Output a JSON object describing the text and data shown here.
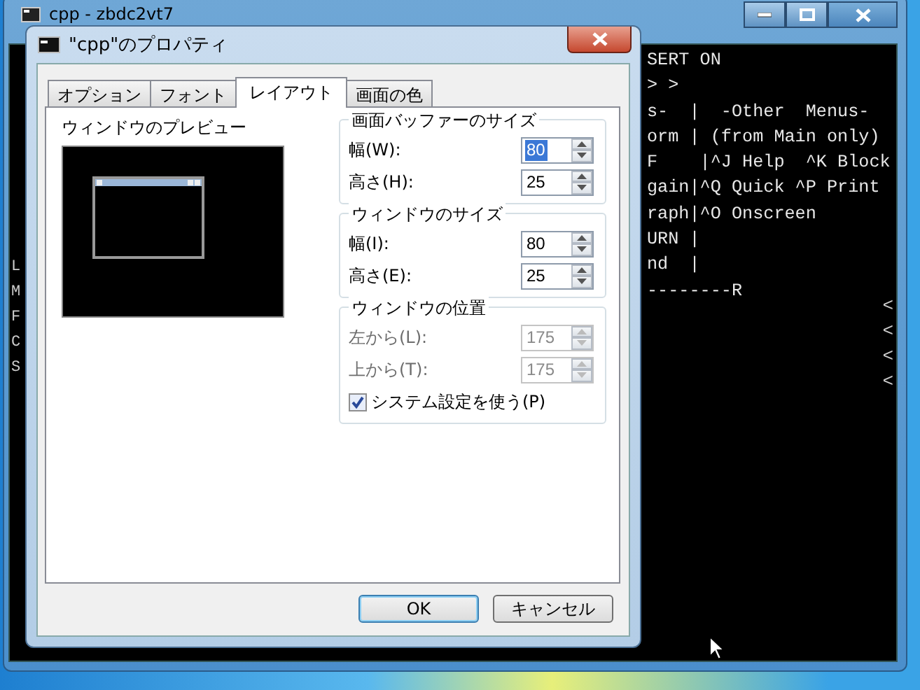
{
  "console_window": {
    "title": "cpp - zbdc2vt7",
    "lines": [
      "SERT ON",
      "> >",
      "s-  |  -Other  Menus-",
      "orm | (from Main only)",
      "F    |^J Help  ^K Block",
      "gain|^Q Quick ^P Print",
      "raph|^O Onscreen",
      "URN |",
      "nd  |",
      "--------R"
    ],
    "left_column": [
      "L",
      "M",
      "F",
      "C",
      "S"
    ],
    "right_column": [
      "<",
      "<",
      "<",
      "<"
    ]
  },
  "dialog": {
    "title": "\"cpp\"のプロパティ",
    "tabs": [
      {
        "label": "オプション",
        "selected": false
      },
      {
        "label": "フォント",
        "selected": false
      },
      {
        "label": "レイアウト",
        "selected": true
      },
      {
        "label": "画面の色",
        "selected": false
      }
    ],
    "preview_label": "ウィンドウのプレビュー",
    "groups": [
      {
        "title": "画面バッファーのサイズ",
        "fields": [
          {
            "label": "幅(W):",
            "value": "80",
            "disabled": false,
            "text_selected": true
          },
          {
            "label": "高さ(H):",
            "value": "25",
            "disabled": false,
            "text_selected": false
          }
        ]
      },
      {
        "title": "ウィンドウのサイズ",
        "fields": [
          {
            "label": "幅(I):",
            "value": "80",
            "disabled": false,
            "text_selected": false
          },
          {
            "label": "高さ(E):",
            "value": "25",
            "disabled": false,
            "text_selected": false
          }
        ]
      },
      {
        "title": "ウィンドウの位置",
        "fields": [
          {
            "label": "左から(L):",
            "value": "175",
            "disabled": true,
            "text_selected": false
          },
          {
            "label": "上から(T):",
            "value": "175",
            "disabled": true,
            "text_selected": false
          }
        ],
        "checkbox": {
          "label": "システム設定を使う(P)",
          "checked": true
        }
      }
    ],
    "buttons": [
      {
        "label": "OK",
        "default": true
      },
      {
        "label": "キャンセル",
        "default": false
      }
    ]
  }
}
